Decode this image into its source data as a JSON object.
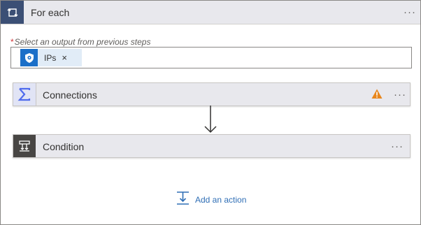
{
  "foreach": {
    "title": "For each",
    "more_label": "···"
  },
  "output_field": {
    "required_mark": "*",
    "label": "Select an output from previous steps",
    "token_label": "IPs",
    "token_remove": "×"
  },
  "actions": [
    {
      "title": "Connections",
      "more_label": "···",
      "warning": true
    },
    {
      "title": "Condition",
      "more_label": "···"
    }
  ],
  "add_action": {
    "label": "Add an action"
  },
  "colors": {
    "foreach_icon_bg": "#3b4f75",
    "token_icon_bg": "#1b6fc8",
    "connections_icon": "#4f6bed",
    "condition_icon_bg": "#484644",
    "warning": "#e8861c",
    "link": "#2f6eb5"
  },
  "icons": {
    "foreach": "loop-icon",
    "token": "shield-icon",
    "connections": "sigma-icon",
    "condition": "condition-icon",
    "warning": "warning-icon",
    "add_action": "add-action-icon"
  }
}
